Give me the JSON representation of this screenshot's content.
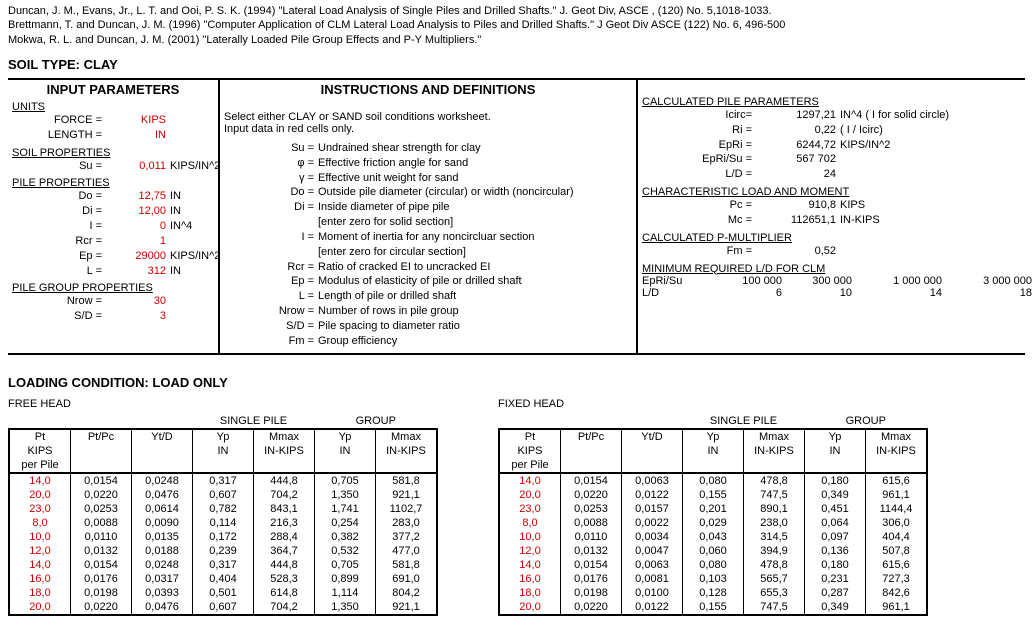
{
  "refs": [
    "Duncan, J. M., Evans, Jr., L. T. and Ooi, P. S. K. (1994) \"Lateral Load Analysis of Single Piles and Drilled Shafts.\"  J. Geot Div, ASCE , (120) No. 5,1018-1033.",
    "Brettmann, T. and Duncan, J. M. (1996) \"Computer Application of CLM Lateral Load Analysis to Piles and Drilled Shafts.\"  J Geot Div ASCE (122) No. 6, 496-500",
    "Mokwa, R. L. and Duncan, J. M. (2001) \"Laterally Loaded Pile Group Effects and P-Y Multipliers.\""
  ],
  "soil_type": "SOIL TYPE: CLAY",
  "headers": {
    "input": "INPUT PARAMETERS",
    "instr": "INSTRUCTIONS AND DEFINITIONS"
  },
  "sections": {
    "units": "UNITS",
    "soilprops": "SOIL PROPERTIES",
    "pileprops": "PILE PROPERTIES",
    "groupprops": "PILE GROUP PROPERTIES",
    "calc_pile": "CALCULATED PILE PARAMETERS",
    "charLM": "CHARACTERISTIC LOAD AND MOMENT",
    "pmult": "CALCULATED P-MULTIPLIER",
    "minLD": "MINIMUM REQUIRED L/D FOR CLM"
  },
  "units": {
    "force_l": "FORCE =",
    "force_v": "KIPS",
    "length_l": "LENGTH =",
    "length_v": "IN"
  },
  "soil": {
    "su_l": "Su =",
    "su_v": "0,011",
    "su_u": "KIPS/IN^2"
  },
  "pile": {
    "do_l": "Do =",
    "do_v": "12,75",
    "do_u": "IN",
    "di_l": "Di =",
    "di_v": "12,00",
    "di_u": "IN",
    "i_l": "I =",
    "i_v": "0",
    "i_u": "IN^4",
    "rcr_l": "Rcr =",
    "rcr_v": "1",
    "rcr_u": "",
    "ep_l": "Ep =",
    "ep_v": "29000",
    "ep_u": "KIPS/IN^2",
    "l_l": "L =",
    "l_v": "312",
    "l_u": "IN"
  },
  "group": {
    "nrow_l": "Nrow =",
    "nrow_v": "30",
    "sd_l": "S/D =",
    "sd_v": "3"
  },
  "instr_intro1": "Select either CLAY or SAND soil conditions worksheet.",
  "instr_intro2": "Input data in red cells only.",
  "defs": [
    {
      "l": "Su =",
      "r": "Undrained shear strength for clay"
    },
    {
      "l": "φ =",
      "r": "Effective friction angle for sand"
    },
    {
      "l": "γ =",
      "r": "Effective unit weight for sand"
    },
    {
      "l": "Do =",
      "r": "Outside pile diameter (circular) or width (noncircular)"
    },
    {
      "l": "Di =",
      "r": "Inside diameter of pipe pile"
    },
    {
      "l": "",
      "r": "[enter zero for solid section]"
    },
    {
      "l": "I =",
      "r": "Moment of inertia for any noncircluar section"
    },
    {
      "l": "",
      "r": "[enter zero for circular section]"
    },
    {
      "l": "Rcr =",
      "r": "Ratio of cracked EI to uncracked EI"
    },
    {
      "l": "Ep =",
      "r": "Modulus of elasticity of pile or drilled shaft"
    },
    {
      "l": "L =",
      "r": "Length of pile or drilled shaft"
    },
    {
      "l": "Nrow =",
      "r": "Number of rows in pile group"
    },
    {
      "l": "S/D =",
      "r": "Pile spacing to diameter ratio"
    },
    {
      "l": "Fm =",
      "r": "Group efficiency"
    }
  ],
  "calc_pile": [
    {
      "l": "Icirc=",
      "v": "1297,21",
      "u": "IN^4  ( I for solid circle)"
    },
    {
      "l": "Ri =",
      "v": "0,22",
      "u": "( I / Icirc)"
    },
    {
      "l": "EpRi =",
      "v": "6244,72",
      "u": "KIPS/IN^2"
    },
    {
      "l": "EpRi/Su =",
      "v": "567 702",
      "u": ""
    },
    {
      "l": "L/D =",
      "v": "24",
      "u": ""
    }
  ],
  "charLM": [
    {
      "l": "Pc =",
      "v": "910,8",
      "u": "KIPS"
    },
    {
      "l": "Mc =",
      "v": "112651,1",
      "u": "IN-KIPS"
    }
  ],
  "pmult": {
    "l": "Fm =",
    "v": "0,52"
  },
  "minLD": {
    "h": [
      "EpRi/Su",
      "100 000",
      "300 000",
      "1 000 000",
      "3 000 000"
    ],
    "r": [
      "L/D",
      "6",
      "10",
      "14",
      "18"
    ]
  },
  "loading_title": "LOADING CONDITION:  LOAD ONLY",
  "cap_free": "FREE HEAD",
  "cap_fixed": "FIXED HEAD",
  "cap_single": "SINGLE PILE",
  "cap_group": "GROUP",
  "cols": {
    "pt1": "Pt",
    "pt2": "KIPS",
    "pt3": "per Pile",
    "ptpc": "Pt/Pc",
    "ytd": "Yt/D",
    "yp1": "Yp",
    "yp2": "IN",
    "mmax1": "Mmax",
    "mmax2": "IN-KIPS"
  },
  "free_rows": [
    {
      "pt": "14,0",
      "ptpc": "0,0154",
      "ytd": "0,0248",
      "yp": "0,317",
      "mmax": "444,8",
      "gyp": "0,705",
      "gmmax": "581,8"
    },
    {
      "pt": "20,0",
      "ptpc": "0,0220",
      "ytd": "0,0476",
      "yp": "0,607",
      "mmax": "704,2",
      "gyp": "1,350",
      "gmmax": "921,1"
    },
    {
      "pt": "23,0",
      "ptpc": "0,0253",
      "ytd": "0,0614",
      "yp": "0,782",
      "mmax": "843,1",
      "gyp": "1,741",
      "gmmax": "1102,7"
    },
    {
      "pt": "8,0",
      "ptpc": "0,0088",
      "ytd": "0,0090",
      "yp": "0,114",
      "mmax": "216,3",
      "gyp": "0,254",
      "gmmax": "283,0"
    },
    {
      "pt": "10,0",
      "ptpc": "0,0110",
      "ytd": "0,0135",
      "yp": "0,172",
      "mmax": "288,4",
      "gyp": "0,382",
      "gmmax": "377,2"
    },
    {
      "pt": "12,0",
      "ptpc": "0,0132",
      "ytd": "0,0188",
      "yp": "0,239",
      "mmax": "364,7",
      "gyp": "0,532",
      "gmmax": "477,0"
    },
    {
      "pt": "14,0",
      "ptpc": "0,0154",
      "ytd": "0,0248",
      "yp": "0,317",
      "mmax": "444,8",
      "gyp": "0,705",
      "gmmax": "581,8"
    },
    {
      "pt": "16,0",
      "ptpc": "0,0176",
      "ytd": "0,0317",
      "yp": "0,404",
      "mmax": "528,3",
      "gyp": "0,899",
      "gmmax": "691,0"
    },
    {
      "pt": "18,0",
      "ptpc": "0,0198",
      "ytd": "0,0393",
      "yp": "0,501",
      "mmax": "614,8",
      "gyp": "1,114",
      "gmmax": "804,2"
    },
    {
      "pt": "20,0",
      "ptpc": "0,0220",
      "ytd": "0,0476",
      "yp": "0,607",
      "mmax": "704,2",
      "gyp": "1,350",
      "gmmax": "921,1"
    }
  ],
  "fixed_rows": [
    {
      "pt": "14,0",
      "ptpc": "0,0154",
      "ytd": "0,0063",
      "yp": "0,080",
      "mmax": "478,8",
      "gyp": "0,180",
      "gmmax": "615,6"
    },
    {
      "pt": "20,0",
      "ptpc": "0,0220",
      "ytd": "0,0122",
      "yp": "0,155",
      "mmax": "747,5",
      "gyp": "0,349",
      "gmmax": "961,1"
    },
    {
      "pt": "23,0",
      "ptpc": "0,0253",
      "ytd": "0,0157",
      "yp": "0,201",
      "mmax": "890,1",
      "gyp": "0,451",
      "gmmax": "1144,4"
    },
    {
      "pt": "8,0",
      "ptpc": "0,0088",
      "ytd": "0,0022",
      "yp": "0,029",
      "mmax": "238,0",
      "gyp": "0,064",
      "gmmax": "306,0"
    },
    {
      "pt": "10,0",
      "ptpc": "0,0110",
      "ytd": "0,0034",
      "yp": "0,043",
      "mmax": "314,5",
      "gyp": "0,097",
      "gmmax": "404,4"
    },
    {
      "pt": "12,0",
      "ptpc": "0,0132",
      "ytd": "0,0047",
      "yp": "0,060",
      "mmax": "394,9",
      "gyp": "0,136",
      "gmmax": "507,8"
    },
    {
      "pt": "14,0",
      "ptpc": "0,0154",
      "ytd": "0,0063",
      "yp": "0,080",
      "mmax": "478,8",
      "gyp": "0,180",
      "gmmax": "615,6"
    },
    {
      "pt": "16,0",
      "ptpc": "0,0176",
      "ytd": "0,0081",
      "yp": "0,103",
      "mmax": "565,7",
      "gyp": "0,231",
      "gmmax": "727,3"
    },
    {
      "pt": "18,0",
      "ptpc": "0,0198",
      "ytd": "0,0100",
      "yp": "0,128",
      "mmax": "655,3",
      "gyp": "0,287",
      "gmmax": "842,6"
    },
    {
      "pt": "20,0",
      "ptpc": "0,0220",
      "ytd": "0,0122",
      "yp": "0,155",
      "mmax": "747,5",
      "gyp": "0,349",
      "gmmax": "961,1"
    }
  ]
}
